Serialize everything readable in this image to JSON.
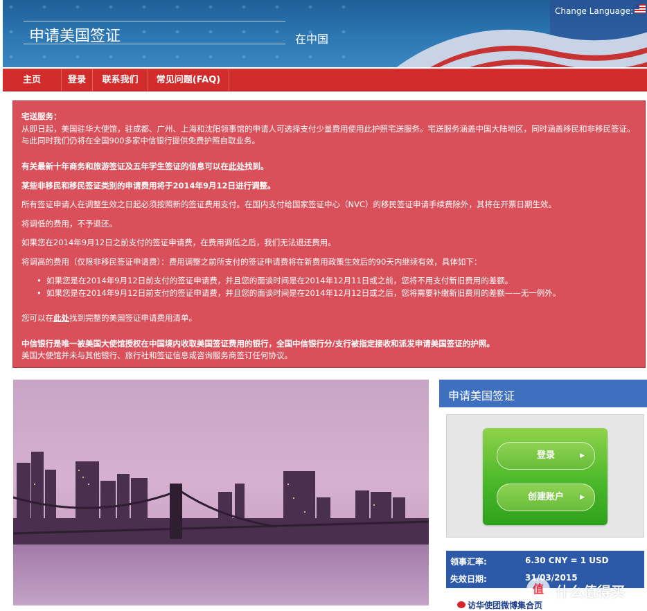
{
  "header": {
    "title": "申请美国签证",
    "subtitle": "在中国",
    "language_label": "Change Language:",
    "flag_icon": "us-flag-icon"
  },
  "nav": {
    "items": [
      {
        "label": "主页"
      },
      {
        "label": "登录"
      },
      {
        "label": "联系我们"
      },
      {
        "label": "常见问题(FAQ)"
      }
    ]
  },
  "notice": {
    "delivery_title": "宅送服务：",
    "delivery_body": "从即日起，美国驻华大使馆，驻成都、广州、上海和沈阳领事馆的申请人可选择支付少量费用使用此护照宅送服务。宅送服务涵盖中国大陆地区，同时涵盖移民和非移民签证。与此同时我们仍将在全国900多家中信银行提供免费护照自取业务。",
    "ten_year_pre": "有关最新十年商务和旅游签证及五年学生签证的信息可以在",
    "ten_year_link": "此处",
    "ten_year_post": "找到。",
    "fee_adjust_title": "某些非移民和移民签证类别的申请费用将于2014年9月12日进行调整。",
    "fee_adjust_body": "所有签证申请人在调整生效之日起必须按照新的签证费用支付。在国内支付给国家签证中心（NVC）的移民签证申请手续费除外，其将在开票日期生效。",
    "no_refund": "将调低的费用，不予退还。",
    "before_paid": "如果您在2014年9月12日之前支付的签证申请费，在费用调低之后，我们无法退还费用。",
    "raised_intro": "将调高的费用（仅限非移民签证申请费）：费用调整之前所支付的签证申请费将在新费用政策生效后的90天内继续有效，具体如下：",
    "bullets": [
      "如果您是在2014年9月12日前支付的签证申请费，并且您的面谈时间是在2014年12月11日或之前，您将不用支付新旧费用的差额。",
      "如果您是在2014年9月12日前支付的签证申请费，并且您的面谈时间是在2014年12月12日或之后，您将需要补缴新旧费用的差额——无一例外。"
    ],
    "fee_list_pre": "您可以在",
    "fee_list_link": "此处",
    "fee_list_post": "找到完整的美国签证申请费用清单。",
    "citic_bold": "中信银行是唯一被美国大使馆授权在中国境内收取美国签证费用的银行，全国中信银行分/支行被指定接收和派发申请美国签证的护照。",
    "citic_body": "美国大使馆并未与其他银行、旅行社和签证信息或咨询服务商签订任何协议。"
  },
  "sidebar": {
    "heading": "申请美国签证",
    "login_label": "登录",
    "create_account_label": "创建账户",
    "rate_label": "领事汇率:",
    "rate_value": "6.30 CNY = 1 USD",
    "expiry_label": "失效日期:",
    "expiry_value": "31/03/2015",
    "weibo_text": "访华使团微博集合页"
  },
  "watermark": {
    "glyph": "值",
    "text": "什么值得买"
  },
  "colors": {
    "nav_red": "#d12b2b",
    "notice_red": "#d9505a",
    "sidebar_blue": "#3f70c0",
    "login_green": "#4cb82b"
  }
}
